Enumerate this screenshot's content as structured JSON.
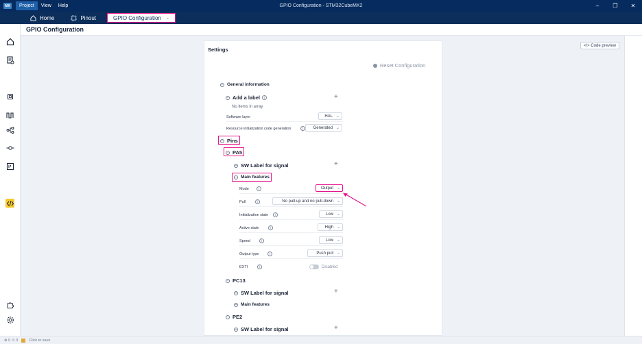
{
  "titlebar": {
    "app_logo": "MX",
    "menu": [
      "Project",
      "View",
      "Help"
    ],
    "window_title": "GPIO Configuration - STM32CubeMX2",
    "controls": [
      "minimize-icon",
      "restore-icon",
      "close-icon"
    ]
  },
  "tabs": [
    {
      "label": "Home",
      "icon": "home-icon"
    },
    {
      "label": "Pinout",
      "icon": "chip-icon"
    },
    {
      "label": "GPIO Configuration",
      "icon": ""
    }
  ],
  "page_title": "GPIO Configuration",
  "code_preview": "</> Code preview",
  "settings": {
    "title": "Settings",
    "reset": "Reset Configuration",
    "general_information": "General information",
    "add_a_label": "Add a label",
    "no_items": "No items in array",
    "software_layer": {
      "label": "Software layer",
      "value": "HAL"
    },
    "resource_init": {
      "label": "Resource initialization code generation",
      "value": "Generated"
    },
    "pins": "Pins",
    "pa5": {
      "name": "PA5",
      "sw_label": "SW Label for signal",
      "main_features": "Main features",
      "fields": [
        {
          "label": "Mode",
          "value": "Output"
        },
        {
          "label": "Pull",
          "value": "No pull-up and no pull-down"
        },
        {
          "label": "Initialization state",
          "value": "Low"
        },
        {
          "label": "Active state",
          "value": "High"
        },
        {
          "label": "Speed",
          "value": "Low"
        },
        {
          "label": "Output type",
          "value": "Push pull"
        },
        {
          "label": "EXTI",
          "value": "Disabled"
        }
      ]
    },
    "pc13": {
      "name": "PC13",
      "sw_label": "SW Label for signal",
      "main_features": "Main features"
    },
    "pe2": {
      "name": "PE2",
      "sw_label": "SW Label for signal"
    }
  },
  "statusbar": {
    "problems": "⊗ 0 ⚠ 0",
    "save": "Click to save"
  },
  "colors": {
    "highlight": "#e5158a",
    "titlebar": "#062b5e",
    "active_rail": "#f7c92f"
  }
}
